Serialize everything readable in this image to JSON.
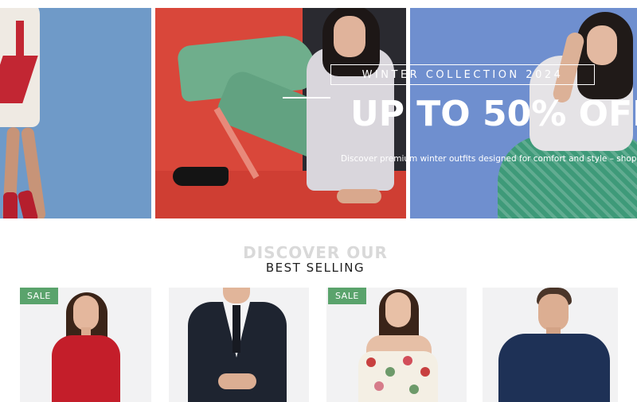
{
  "hero": {
    "tag": "WINTER COLLECTION 2024",
    "headline": "UP TO 50% OFF",
    "subtext": "Discover premium winter outfits designed for comfort and style – shop before"
  },
  "section": {
    "heading_top": "DISCOVER OUR",
    "heading_main": "BEST SELLING"
  },
  "products": [
    {
      "badge": "SALE"
    },
    {
      "badge": ""
    },
    {
      "badge": "SALE"
    },
    {
      "badge": ""
    }
  ],
  "colors": {
    "sale_badge": "#5aa36c",
    "heading_faded": "#d9d9d9"
  }
}
